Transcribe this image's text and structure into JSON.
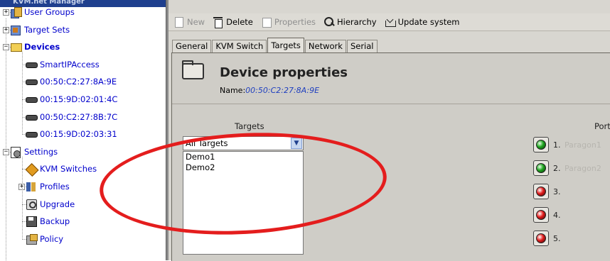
{
  "window": {
    "title": "KVM.net Manager"
  },
  "tree": {
    "items": [
      {
        "id": "user-groups",
        "label": "User Groups",
        "icon": "user-group-icon",
        "expander": "+"
      },
      {
        "id": "target-sets",
        "label": "Target Sets",
        "icon": "target-sets-icon",
        "expander": "+"
      },
      {
        "id": "devices",
        "label": "Devices",
        "icon": "devices-folder-icon",
        "expander": "−"
      },
      {
        "id": "smartipaccess",
        "label": "SmartIPAccess",
        "icon": "switch-device-icon"
      },
      {
        "id": "dev1",
        "label": "00:50:C2:27:8A:9E",
        "icon": "switch-device-icon"
      },
      {
        "id": "dev2",
        "label": "00:15:9D:02:01:4C",
        "icon": "switch-device-icon"
      },
      {
        "id": "dev3",
        "label": "00:50:C2:27:8B:7C",
        "icon": "switch-device-icon"
      },
      {
        "id": "dev4",
        "label": "00:15:9D:02:03:31",
        "icon": "switch-device-icon"
      },
      {
        "id": "settings",
        "label": "Settings",
        "icon": "settings-icon",
        "expander": "−"
      },
      {
        "id": "kvm-switches",
        "label": "KVM Switches",
        "icon": "kvm-switch-icon"
      },
      {
        "id": "profiles",
        "label": "Profiles",
        "icon": "profiles-icon",
        "expander": "+"
      },
      {
        "id": "upgrade",
        "label": "Upgrade",
        "icon": "upgrade-icon"
      },
      {
        "id": "backup",
        "label": "Backup",
        "icon": "backup-icon"
      },
      {
        "id": "policy",
        "label": "Policy",
        "icon": "policy-icon"
      }
    ]
  },
  "toolbar": {
    "new": "New",
    "delete": "Delete",
    "properties": "Properties",
    "hierarchy": "Hierarchy",
    "update_system": "Update system"
  },
  "tabs": [
    "General",
    "KVM Switch",
    "Targets",
    "Network",
    "Serial"
  ],
  "active_tab": "Targets",
  "device": {
    "heading": "Device properties",
    "name_label": "Name:",
    "name_value": "00:50:C2:27:8A:9E"
  },
  "targets": {
    "label": "Targets",
    "selected": "All Targets",
    "items": [
      "Demo1",
      "Demo2"
    ]
  },
  "ports": {
    "label": "Ports",
    "items": [
      {
        "num": "1.",
        "name": "Paragon1",
        "status": "green"
      },
      {
        "num": "2.",
        "name": "Paragon2",
        "status": "green"
      },
      {
        "num": "3.",
        "name": "",
        "status": "red"
      },
      {
        "num": "4.",
        "name": "",
        "status": "red"
      },
      {
        "num": "5.",
        "name": "",
        "status": "red"
      }
    ]
  },
  "colors": {
    "link_blue": "#0000cc",
    "annotation_red": "#e41d1d",
    "led_green": "#1fa51f",
    "led_red": "#e21b1b"
  }
}
